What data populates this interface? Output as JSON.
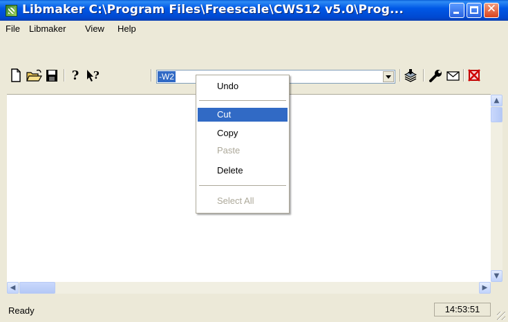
{
  "window": {
    "title": "Libmaker  C:\\Program Files\\Freescale\\CWS12 v5.0\\Prog...",
    "icon": "libmaker-app-icon",
    "controls": {
      "minimize": "minimize-icon",
      "maximize": "maximize-icon",
      "close": "✕"
    }
  },
  "menubar": {
    "items": [
      {
        "label": "File"
      },
      {
        "label": "Libmaker"
      },
      {
        "label": "View"
      },
      {
        "label": "Help"
      }
    ]
  },
  "toolbar": {
    "icons": [
      "new-file-icon",
      "open-folder-icon",
      "save-icon",
      "help-icon",
      "context-help-icon",
      "build-icon",
      "options-wrench-icon",
      "mail-icon",
      "stop-icon"
    ],
    "combo": {
      "value": "-W2"
    }
  },
  "context_menu": {
    "items": [
      {
        "label": "Undo",
        "state": "enabled"
      },
      {
        "label": "Cut",
        "state": "highlighted"
      },
      {
        "label": "Copy",
        "state": "enabled"
      },
      {
        "label": "Paste",
        "state": "disabled"
      },
      {
        "label": "Delete",
        "state": "enabled"
      },
      {
        "label": "Select All",
        "state": "disabled"
      }
    ]
  },
  "statusbar": {
    "text": "Ready",
    "clock": "14:53:51"
  },
  "colors": {
    "titlebar": "#0058e6",
    "highlight": "#316ac5",
    "disabled_text": "#aca899"
  }
}
